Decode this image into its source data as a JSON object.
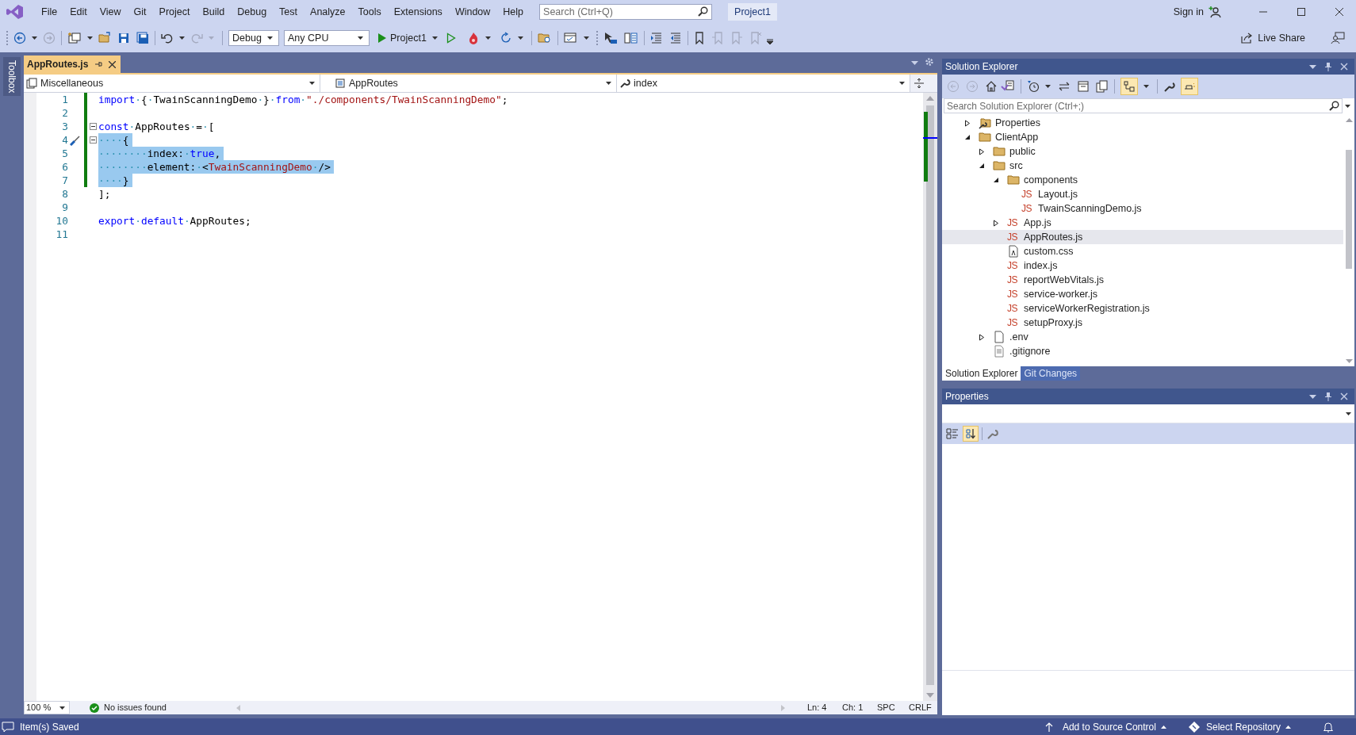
{
  "menu": [
    "File",
    "Edit",
    "View",
    "Git",
    "Project",
    "Build",
    "Debug",
    "Test",
    "Analyze",
    "Tools",
    "Extensions",
    "Window",
    "Help"
  ],
  "search": {
    "placeholder": "Search (Ctrl+Q)"
  },
  "solution_name": "Project1",
  "sign_in": "Sign in",
  "toolbar": {
    "configuration": "Debug",
    "platform": "Any CPU",
    "run_target": "Project1",
    "live_share": "Live Share"
  },
  "toolbox_label": "Toolbox",
  "editor": {
    "tabs": [
      {
        "label": "AppRoutes.js",
        "selected": true
      }
    ],
    "navigation": [
      "Miscellaneous",
      "AppRoutes",
      "index"
    ],
    "lines": [
      {
        "number": "1",
        "modified": true,
        "selected": false,
        "fold": false,
        "quick_action": false,
        "tokens": [
          {
            "kind": "keyword",
            "text": "import"
          },
          {
            "kind": "space",
            "text": "·"
          },
          {
            "kind": "plain",
            "text": "{"
          },
          {
            "kind": "space",
            "text": "·"
          },
          {
            "kind": "plain",
            "text": "TwainScanningDemo"
          },
          {
            "kind": "space",
            "text": "·"
          },
          {
            "kind": "plain",
            "text": "}"
          },
          {
            "kind": "space",
            "text": "·"
          },
          {
            "kind": "keyword",
            "text": "from"
          },
          {
            "kind": "space",
            "text": "·"
          },
          {
            "kind": "string",
            "text": "\"./components/TwainScanningDemo\""
          },
          {
            "kind": "plain",
            "text": ";"
          }
        ]
      },
      {
        "number": "2",
        "modified": true,
        "selected": false,
        "fold": false,
        "quick_action": false
      },
      {
        "number": "3",
        "modified": true,
        "selected": false,
        "fold": true,
        "quick_action": false,
        "tokens": [
          {
            "kind": "keyword",
            "text": "const"
          },
          {
            "kind": "space",
            "text": "·"
          },
          {
            "kind": "plain",
            "text": "AppRoutes"
          },
          {
            "kind": "space",
            "text": "·"
          },
          {
            "kind": "plain",
            "text": "="
          },
          {
            "kind": "space",
            "text": "·"
          },
          {
            "kind": "plain",
            "text": "["
          }
        ]
      },
      {
        "number": "4",
        "modified": true,
        "selected": true,
        "fold": true,
        "quick_action": true,
        "tokens": [
          {
            "kind": "space",
            "text": "····"
          },
          {
            "kind": "plain",
            "text": "{"
          }
        ]
      },
      {
        "number": "5",
        "modified": true,
        "selected": true,
        "fold": false,
        "quick_action": false,
        "tokens": [
          {
            "kind": "space",
            "text": "········"
          },
          {
            "kind": "plain",
            "text": "index:"
          },
          {
            "kind": "space",
            "text": "·"
          },
          {
            "kind": "keyword",
            "text": "true"
          },
          {
            "kind": "plain",
            "text": ","
          }
        ]
      },
      {
        "number": "6",
        "modified": true,
        "selected": true,
        "fold": false,
        "quick_action": false,
        "tokens": [
          {
            "kind": "space",
            "text": "········"
          },
          {
            "kind": "plain",
            "text": "element:"
          },
          {
            "kind": "space",
            "text": "·"
          },
          {
            "kind": "plain",
            "text": "<"
          },
          {
            "kind": "tag",
            "text": "TwainScanningDemo"
          },
          {
            "kind": "space",
            "text": "·"
          },
          {
            "kind": "plain",
            "text": "/>"
          }
        ]
      },
      {
        "number": "7",
        "modified": true,
        "selected": true,
        "fold": false,
        "quick_action": false,
        "tokens": [
          {
            "kind": "space",
            "text": "····"
          },
          {
            "kind": "plain",
            "text": "}"
          }
        ]
      },
      {
        "number": "8",
        "modified": false,
        "selected": false,
        "fold": false,
        "quick_action": false,
        "tokens": [
          {
            "kind": "plain",
            "text": "];"
          }
        ]
      },
      {
        "number": "9",
        "modified": false,
        "selected": false,
        "fold": false,
        "quick_action": false
      },
      {
        "number": "10",
        "modified": false,
        "selected": false,
        "fold": false,
        "quick_action": false,
        "tokens": [
          {
            "kind": "keyword",
            "text": "export"
          },
          {
            "kind": "space",
            "text": "·"
          },
          {
            "kind": "keyword",
            "text": "default"
          },
          {
            "kind": "space",
            "text": "·"
          },
          {
            "kind": "plain",
            "text": "AppRoutes;"
          }
        ]
      },
      {
        "number": "11",
        "modified": false,
        "selected": false,
        "fold": false,
        "quick_action": false
      }
    ],
    "zoom": "100 %",
    "issues": "No issues found",
    "line": "Ln: 4",
    "column": "Ch: 1",
    "whitespace": "SPC",
    "line_endings": "CRLF"
  },
  "solution_explorer": {
    "title": "Solution Explorer",
    "search": {
      "placeholder": "Search Solution Explorer (Ctrl+;)"
    },
    "tree": [
      {
        "label": "Properties",
        "kind": "properties",
        "expanded": false,
        "selected": false
      },
      {
        "label": "ClientApp",
        "kind": "folder",
        "expanded": true,
        "selected": false,
        "children": [
          {
            "label": "public",
            "kind": "folder",
            "expanded": false,
            "selected": false
          },
          {
            "label": "src",
            "kind": "folder",
            "expanded": true,
            "selected": false,
            "children": [
              {
                "label": "components",
                "kind": "folder",
                "expanded": true,
                "selected": false,
                "children": [
                  {
                    "label": "Layout.js",
                    "kind": "js",
                    "badge": "JS",
                    "selected": false
                  },
                  {
                    "label": "TwainScanningDemo.js",
                    "kind": "js",
                    "badge": "JS",
                    "selected": false
                  }
                ]
              },
              {
                "label": "App.js",
                "kind": "js",
                "badge": "JS",
                "expanded": false,
                "selected": false
              },
              {
                "label": "AppRoutes.js",
                "kind": "js",
                "badge": "JS",
                "selected": true
              },
              {
                "label": "custom.css",
                "kind": "css",
                "selected": false
              },
              {
                "label": "index.js",
                "kind": "js",
                "badge": "JS",
                "selected": false
              },
              {
                "label": "reportWebVitals.js",
                "kind": "js",
                "badge": "JS",
                "selected": false
              },
              {
                "label": "service-worker.js",
                "kind": "js",
                "badge": "JS",
                "selected": false
              },
              {
                "label": "serviceWorkerRegistration.js",
                "kind": "js",
                "badge": "JS",
                "selected": false
              },
              {
                "label": "setupProxy.js",
                "kind": "js",
                "badge": "JS",
                "selected": false
              }
            ]
          },
          {
            "label": ".env",
            "kind": "file",
            "expanded": false,
            "selected": false
          },
          {
            "label": ".gitignore",
            "kind": "text",
            "selected": false
          }
        ]
      }
    ],
    "tabs": [
      {
        "label": "Solution Explorer",
        "selected": true
      },
      {
        "label": "Git Changes",
        "selected": false
      }
    ]
  },
  "properties": {
    "title": "Properties"
  },
  "status_bar": {
    "message": "Item(s) Saved",
    "source_control": "Add to Source Control",
    "repository": "Select Repository"
  }
}
